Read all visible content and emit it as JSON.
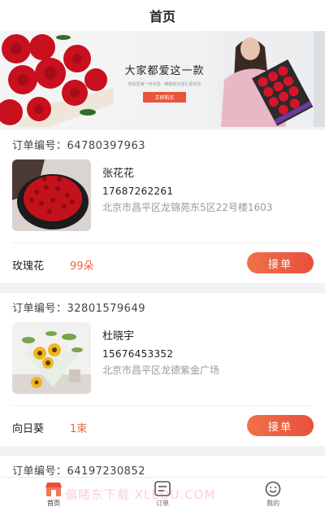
{
  "header": {
    "title": "首页"
  },
  "banner": {
    "headline": "大家都爱这一款",
    "subtext": "情侣爱第一时间选 · 精致鲜花送礼更有范",
    "button_label": "立即购买"
  },
  "orders": [
    {
      "order_label": "订单编号：64780397963",
      "name": "张花花",
      "phone": "17687262261",
      "address": "北京市昌平区龙锦苑东5区22号楼1603",
      "product": "玫瑰花",
      "quantity": "99朵",
      "button": "接单"
    },
    {
      "order_label": "订单编号：32801579649",
      "name": "杜晓宇",
      "phone": "15676453352",
      "address": "北京市昌平区龙德紫金广场",
      "product": "向日葵",
      "quantity": "1束",
      "button": "接单"
    },
    {
      "order_label": "订单编号：64197230852"
    }
  ],
  "tabbar": {
    "items": [
      {
        "label": "首页"
      },
      {
        "label": "订单"
      },
      {
        "label": "我的"
      }
    ],
    "active_color": "#e8503c"
  },
  "watermark": "偏睹东下载 XLEDU.COM"
}
